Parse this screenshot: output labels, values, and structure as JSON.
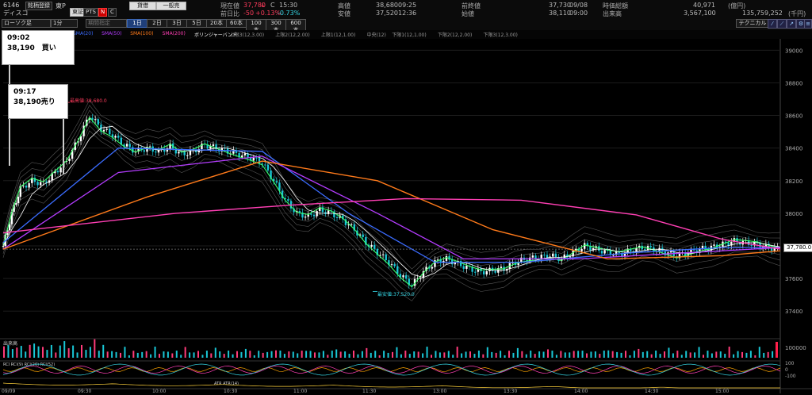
{
  "header": {
    "code": "6146",
    "name": "ディスコ",
    "tag1": "銘柄登録",
    "tag2": "東P",
    "market": "東証",
    "pts": "PTS",
    "n_icon": "N",
    "c_icon": "C",
    "tab_rate": "貸借",
    "tab_general": "一般売",
    "current_label": "現在値",
    "current_value": "37,780",
    "current_arrow": "↓",
    "current_c": "C",
    "current_time": "15:30",
    "change_label": "前日比",
    "change_value": "-50",
    "change_pct": "+0.13%",
    "change_pct2": "-0.73%",
    "high_label": "高値",
    "high_value": "38,680",
    "high_time": "09:25",
    "low_label": "安値",
    "low_value": "37,520",
    "low_time": "12:36",
    "prev_close_label": "前終値",
    "prev_close_value": "37,730",
    "prev_close_date": "09/08",
    "open_label": "始値",
    "open_value": "38,110",
    "open_time": "09:00",
    "market_cap_label": "時価総額",
    "market_cap_value": "40,971",
    "market_cap_unit": "(億円)",
    "volume_label": "出来高",
    "volume_value": "3,567,100",
    "turnover_value": "135,759,252",
    "turnover_unit": "(千円)"
  },
  "toolbar": {
    "chart_type": "ローソク足",
    "interval": "1分",
    "period_placeholder": "期間指定",
    "periods": [
      "1日",
      "2日",
      "3日",
      "5日",
      "20本",
      "60本",
      "100本",
      "300本",
      "600本"
    ],
    "active_period": "1日",
    "technical": "テクニカル"
  },
  "legend": {
    "items": [
      {
        "label": "SMA(20)",
        "color": "#3b6cff"
      },
      {
        "label": "SMA(50)",
        "color": "#b43cff"
      },
      {
        "label": "SMA(100)",
        "color": "#ff7a1a"
      },
      {
        "label": "SMA(200)",
        "color": "#ff3fb4"
      },
      {
        "label": "ボリンジャーバンド",
        "color": "#ffffff"
      },
      {
        "label": "上限3(12,3.00)",
        "color": "#9a9a9a"
      },
      {
        "label": "上限2(12,2.00)",
        "color": "#9a9a9a"
      },
      {
        "label": "上限1(12,1.00)",
        "color": "#9a9a9a"
      },
      {
        "label": "中央(12)",
        "color": "#9a9a9a"
      },
      {
        "label": "下限1(12,1.00)",
        "color": "#9a9a9a"
      },
      {
        "label": "下限2(12,2.00)",
        "color": "#9a9a9a"
      },
      {
        "label": "下限3(12,3.00)",
        "color": "#9a9a9a"
      }
    ]
  },
  "annotations": {
    "buy_time": "09:02",
    "buy_text": "38,190　買い",
    "sell_time": "09:17",
    "sell_text": "38,190売り",
    "high_marker": "最高値:38,680.0",
    "low_marker": "最安値:37,520.0",
    "current_price_box": "37,780.0"
  },
  "chart_data": {
    "type": "candlestick",
    "x_labels": [
      "09/09",
      "09:30",
      "10:00",
      "10:30",
      "11:00",
      "11:30",
      "13:00",
      "13:30",
      "14:00",
      "14:30",
      "15:00"
    ],
    "y_ticks": [
      39000,
      38800,
      38600,
      38400,
      38200,
      38000,
      37800,
      37600,
      37400
    ],
    "ylim": [
      37260,
      39060
    ],
    "volume_label": "出来高",
    "volume_max_label": "100000",
    "rci_label": "RCI",
    "rci_legend": "RCI(9) RCI(26) RCI(52)",
    "rci_ticks": [
      "100",
      "0",
      "-100"
    ],
    "atr_label": "ATR",
    "atr_legend": "ATR(14)",
    "close_path": [
      [
        0,
        37800
      ],
      [
        3,
        38000
      ],
      [
        6,
        38150
      ],
      [
        10,
        38200
      ],
      [
        14,
        38180
      ],
      [
        18,
        38250
      ],
      [
        22,
        38320
      ],
      [
        26,
        38450
      ],
      [
        30,
        38600
      ],
      [
        34,
        38520
      ],
      [
        38,
        38480
      ],
      [
        42,
        38420
      ],
      [
        46,
        38380
      ],
      [
        50,
        38400
      ],
      [
        54,
        38380
      ],
      [
        58,
        38410
      ],
      [
        62,
        38360
      ],
      [
        66,
        38380
      ],
      [
        70,
        38420
      ],
      [
        74,
        38400
      ],
      [
        78,
        38380
      ],
      [
        82,
        38360
      ],
      [
        86,
        38340
      ],
      [
        90,
        38310
      ],
      [
        94,
        38200
      ],
      [
        98,
        38080
      ],
      [
        102,
        38000
      ],
      [
        106,
        37980
      ],
      [
        110,
        38020
      ],
      [
        114,
        38000
      ],
      [
        118,
        37960
      ],
      [
        122,
        37900
      ],
      [
        126,
        37820
      ],
      [
        130,
        37760
      ],
      [
        134,
        37700
      ],
      [
        138,
        37620
      ],
      [
        142,
        37560
      ],
      [
        146,
        37640
      ],
      [
        150,
        37700
      ],
      [
        154,
        37720
      ],
      [
        158,
        37690
      ],
      [
        162,
        37660
      ],
      [
        166,
        37640
      ],
      [
        170,
        37650
      ],
      [
        174,
        37660
      ],
      [
        178,
        37700
      ],
      [
        182,
        37720
      ],
      [
        186,
        37730
      ],
      [
        190,
        37740
      ],
      [
        194,
        37720
      ],
      [
        198,
        37760
      ],
      [
        202,
        37800
      ],
      [
        206,
        37780
      ],
      [
        210,
        37760
      ],
      [
        214,
        37750
      ],
      [
        218,
        37770
      ],
      [
        222,
        37790
      ],
      [
        226,
        37780
      ],
      [
        230,
        37760
      ],
      [
        234,
        37740
      ],
      [
        238,
        37760
      ],
      [
        242,
        37780
      ],
      [
        246,
        37790
      ],
      [
        250,
        37810
      ],
      [
        254,
        37830
      ],
      [
        258,
        37820
      ],
      [
        262,
        37810
      ],
      [
        266,
        37790
      ],
      [
        270,
        37780
      ]
    ],
    "sma20": [
      [
        0,
        37820
      ],
      [
        40,
        38400
      ],
      [
        90,
        38380
      ],
      [
        120,
        38000
      ],
      [
        150,
        37700
      ],
      [
        180,
        37700
      ],
      [
        220,
        37760
      ],
      [
        250,
        37790
      ],
      [
        270,
        37790
      ]
    ],
    "sma50": [
      [
        0,
        37780
      ],
      [
        40,
        38250
      ],
      [
        90,
        38350
      ],
      [
        130,
        38000
      ],
      [
        160,
        37720
      ],
      [
        200,
        37720
      ],
      [
        240,
        37760
      ],
      [
        270,
        37790
      ]
    ],
    "sma100": [
      [
        0,
        37780
      ],
      [
        50,
        38100
      ],
      [
        90,
        38320
      ],
      [
        130,
        38200
      ],
      [
        170,
        37900
      ],
      [
        210,
        37720
      ],
      [
        250,
        37740
      ],
      [
        270,
        37770
      ]
    ],
    "sma200": [
      [
        0,
        37880
      ],
      [
        60,
        38000
      ],
      [
        100,
        38050
      ],
      [
        140,
        38090
      ],
      [
        180,
        38080
      ],
      [
        220,
        37990
      ],
      [
        250,
        37840
      ],
      [
        270,
        37780
      ]
    ]
  }
}
